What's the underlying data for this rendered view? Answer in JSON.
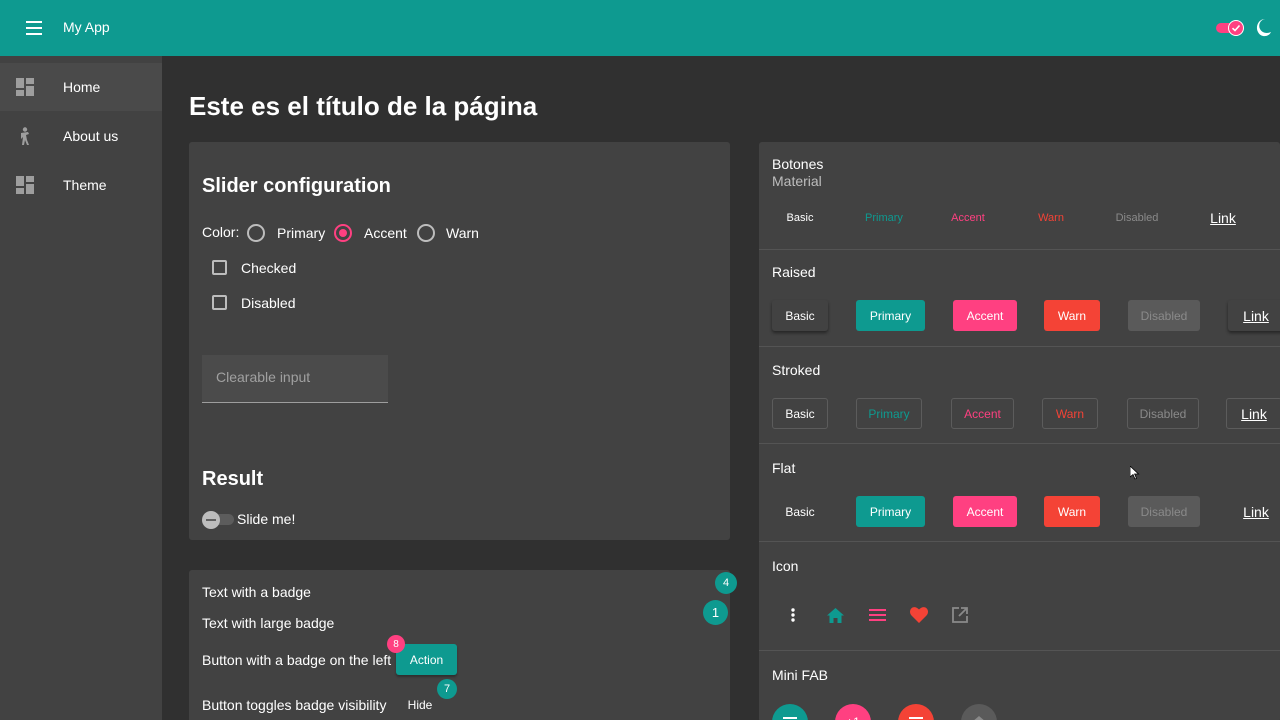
{
  "toolbar": {
    "app_title": "My App"
  },
  "sidebar": {
    "items": [
      {
        "label": "Home",
        "icon": "dashboard-icon"
      },
      {
        "label": "About us",
        "icon": "person-icon"
      },
      {
        "label": "Theme",
        "icon": "dashboard-icon"
      }
    ]
  },
  "main": {
    "page_title": "Este es el título de la página"
  },
  "slider_card": {
    "title": "Slider configuration",
    "color_label": "Color:",
    "radios": [
      "Primary",
      "Accent",
      "Warn"
    ],
    "selected_radio": "Accent",
    "checkboxes": [
      "Checked",
      "Disabled"
    ],
    "input_placeholder": "Clearable input",
    "result_title": "Result",
    "slide_label": "Slide me!"
  },
  "badge_card": {
    "text_badge": "Text with a badge",
    "text_badge_value": "4",
    "text_large_badge": "Text with large badge",
    "text_large_badge_value": "1",
    "button_badge_left": "Button with a badge on the left",
    "button_badge_left_value": "8",
    "action_label": "Action",
    "toggle_label": "Button toggles badge visibility",
    "toggle_badge_value": "7",
    "hide_label": "Hide"
  },
  "buttons_card": {
    "title": "Botones",
    "subtitle": "Material",
    "labels": {
      "basic": "Basic",
      "primary": "Primary",
      "accent": "Accent",
      "warn": "Warn",
      "disabled": "Disabled",
      "link": "Link"
    },
    "sections": {
      "raised": "Raised",
      "stroked": "Stroked",
      "flat": "Flat",
      "icon": "Icon",
      "mini_fab": "Mini FAB"
    },
    "mini_fab_plus": "+1"
  },
  "colors": {
    "primary": "#0e9a90",
    "accent": "#ff4081",
    "warn": "#f44336"
  }
}
